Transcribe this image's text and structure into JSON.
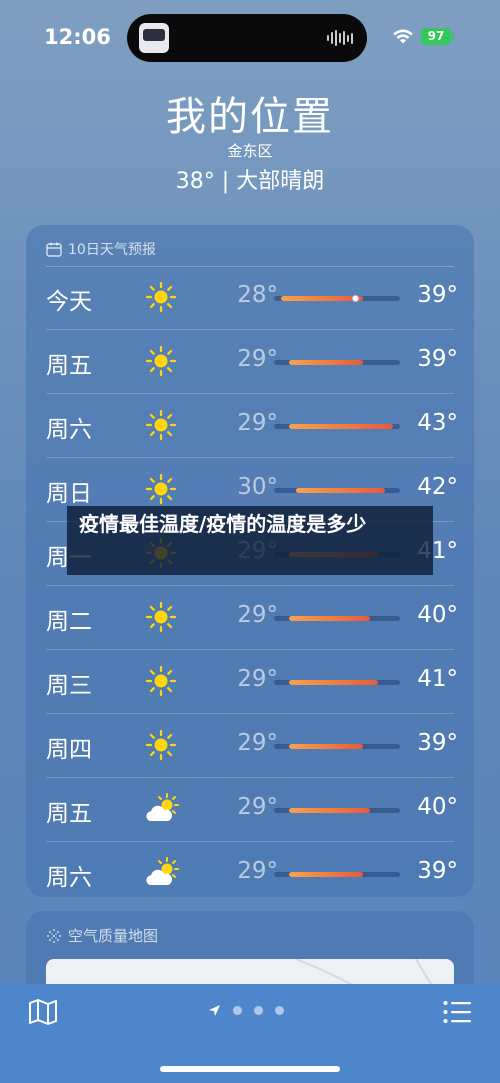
{
  "status_bar": {
    "time": "12:06",
    "battery": "97"
  },
  "location": {
    "title": "我的位置",
    "district": "金东区",
    "current": "38° | 大部晴朗"
  },
  "forecast": {
    "header": "10日天气预报",
    "days": [
      {
        "day": "今天",
        "icon": "sun-icon",
        "low": "28°",
        "high": "39°",
        "range": [
          28,
          39
        ],
        "current": 38
      },
      {
        "day": "周五",
        "icon": "sun-icon",
        "low": "29°",
        "high": "39°",
        "range": [
          29,
          39
        ]
      },
      {
        "day": "周六",
        "icon": "sun-icon",
        "low": "29°",
        "high": "43°",
        "range": [
          29,
          43
        ]
      },
      {
        "day": "周日",
        "icon": "sun-icon",
        "low": "30°",
        "high": "42°",
        "range": [
          30,
          42
        ]
      },
      {
        "day": "周一",
        "icon": "sun-icon",
        "low": "29°",
        "high": "41°",
        "range": [
          29,
          41
        ]
      },
      {
        "day": "周二",
        "icon": "sun-icon",
        "low": "29°",
        "high": "40°",
        "range": [
          29,
          40
        ]
      },
      {
        "day": "周三",
        "icon": "sun-icon",
        "low": "29°",
        "high": "41°",
        "range": [
          29,
          41
        ]
      },
      {
        "day": "周四",
        "icon": "sun-icon",
        "low": "29°",
        "high": "39°",
        "range": [
          29,
          39
        ]
      },
      {
        "day": "周五",
        "icon": "partly-cloudy-icon",
        "low": "29°",
        "high": "40°",
        "range": [
          29,
          40
        ]
      },
      {
        "day": "周六",
        "icon": "partly-cloudy-icon",
        "low": "29°",
        "high": "39°",
        "range": [
          29,
          39
        ]
      }
    ]
  },
  "air_quality": {
    "header": "空气质量地图"
  },
  "banner": {
    "text": "疫情最佳温度/疫情的温度是多少"
  },
  "colors": {
    "accent_bar_start": "#f7a34b",
    "accent_bar_end": "#e85a3c",
    "battery": "#34c759"
  }
}
